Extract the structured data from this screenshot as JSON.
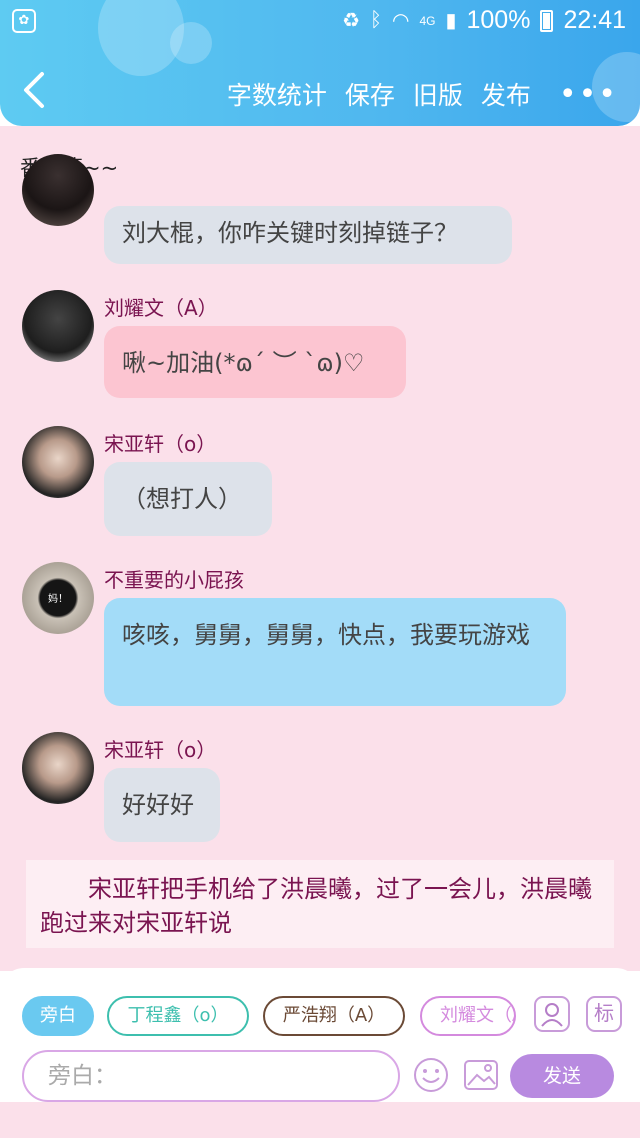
{
  "status_bar": {
    "battery": "100%",
    "time": "22:41",
    "network": "4G"
  },
  "header": {
    "actions": [
      "字数统计",
      "保存",
      "旧版",
      "发布"
    ],
    "more": "•••"
  },
  "chapter_title": "番外篇~~",
  "messages": [
    {
      "name": "",
      "text": "刘大棍，你咋关键时刻掉链子？",
      "style": "gray"
    },
    {
      "name": "刘耀文（A）",
      "text": "啾~加油(*ɷ´ ︶ `ɷ)♡",
      "style": "pink"
    },
    {
      "name": "宋亚轩（o）",
      "text": "（想打人）",
      "style": "gray"
    },
    {
      "name": "不重要的小屁孩",
      "text": "咳咳，舅舅，舅舅，快点，我要玩游戏",
      "style": "blue",
      "avatar_label": "妈！"
    },
    {
      "name": "宋亚轩（o）",
      "text": "好好好",
      "style": "gray"
    }
  ],
  "narration": "宋亚轩把手机给了洪晨曦，过了一会儿，洪晨曦跑过来对宋亚轩说",
  "characters": [
    {
      "label": "旁白",
      "active": true,
      "color": "#6ac9f0"
    },
    {
      "label": "丁程鑫（o）",
      "active": false,
      "color": "#3dbfae"
    },
    {
      "label": "严浩翔（A）",
      "active": false,
      "color": "#6b4a36"
    },
    {
      "label": "刘耀文（A）",
      "active": false,
      "color": "#d48ade"
    }
  ],
  "icon_buttons": {
    "person": "person-card-icon",
    "tag": "标"
  },
  "input": {
    "placeholder": "旁白："
  },
  "send_label": "发送",
  "colors": {
    "header": "#4fb7ef",
    "background": "#fbe0ea",
    "name": "#7a1450",
    "accent": "#b88ae0"
  }
}
